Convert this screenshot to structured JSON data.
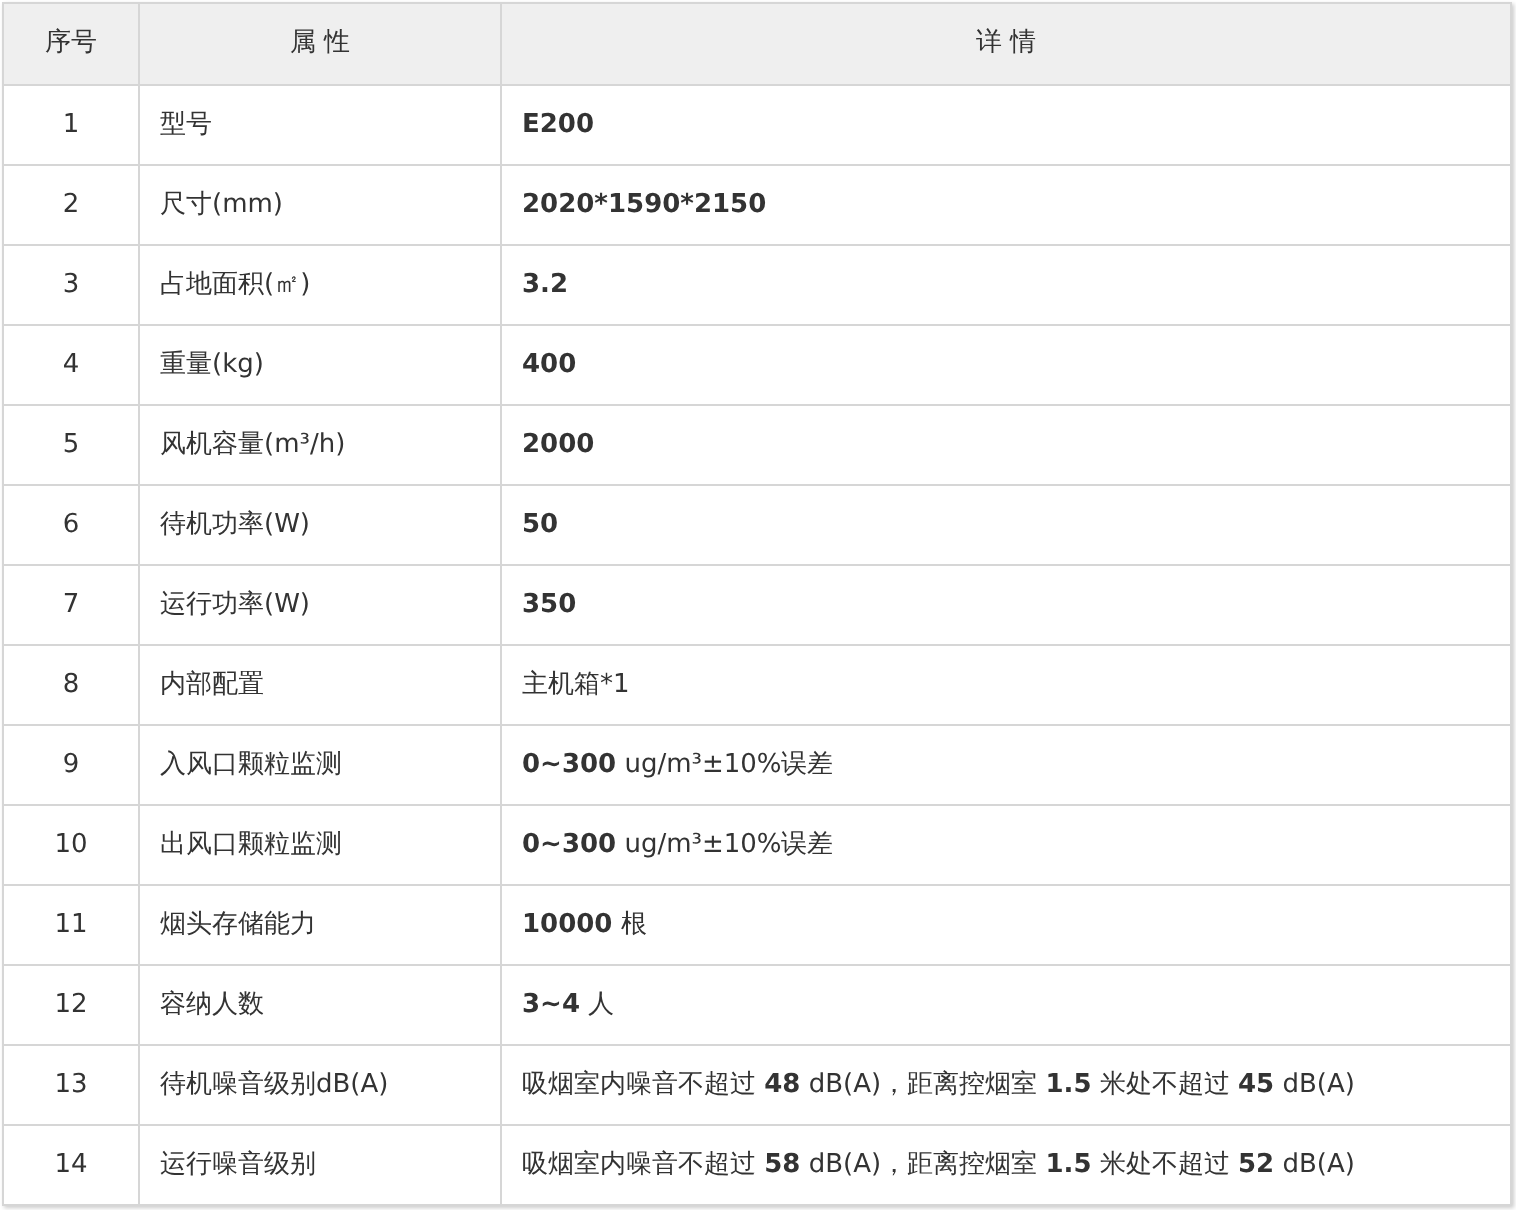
{
  "table": {
    "columns": [
      "序号",
      "属 性",
      "详 情"
    ],
    "rows": [
      {
        "index": "1",
        "attribute": "型号",
        "detail": "E200",
        "bold": true
      },
      {
        "index": "2",
        "attribute": "尺寸(mm)",
        "detail": "2020*1590*2150",
        "bold": true
      },
      {
        "index": "3",
        "attribute": "占地面积(㎡)",
        "detail": "3.2",
        "bold": true
      },
      {
        "index": "4",
        "attribute": "重量(kg)",
        "detail": "400",
        "bold": true
      },
      {
        "index": "5",
        "attribute": "风机容量(m³/h)",
        "detail": "2000",
        "bold": true
      },
      {
        "index": "6",
        "attribute": "待机功率(W)",
        "detail": "50",
        "bold": true
      },
      {
        "index": "7",
        "attribute": "运行功率(W)",
        "detail": "350",
        "bold": true
      },
      {
        "index": "8",
        "attribute": "内部配置",
        "detail": "主机箱*1",
        "bold": false
      },
      {
        "index": "9",
        "attribute": "入风口颗粒监测",
        "detail": "**0~300** ug/m³±10%误差",
        "bold": false
      },
      {
        "index": "10",
        "attribute": "出风口颗粒监测",
        "detail": "**0~300** ug/m³±10%误差",
        "bold": false
      },
      {
        "index": "11",
        "attribute": "烟头存储能力",
        "detail": "**10000** 根",
        "bold": false
      },
      {
        "index": "12",
        "attribute": "容纳人数",
        "detail": "**3~4** 人",
        "bold": false
      },
      {
        "index": "13",
        "attribute": "待机噪音级别dB(A)",
        "detail": "吸烟室内噪音不超过 **48** dB(A)，距离控烟室 **1.5** 米处不超过 **45** dB(A)",
        "bold": false
      },
      {
        "index": "14",
        "attribute": "运行噪音级别",
        "detail": "吸烟室内噪音不超过 **58** dB(A)，距离控烟室 **1.5** 米处不超过 **52** dB(A)",
        "bold": false
      }
    ]
  }
}
